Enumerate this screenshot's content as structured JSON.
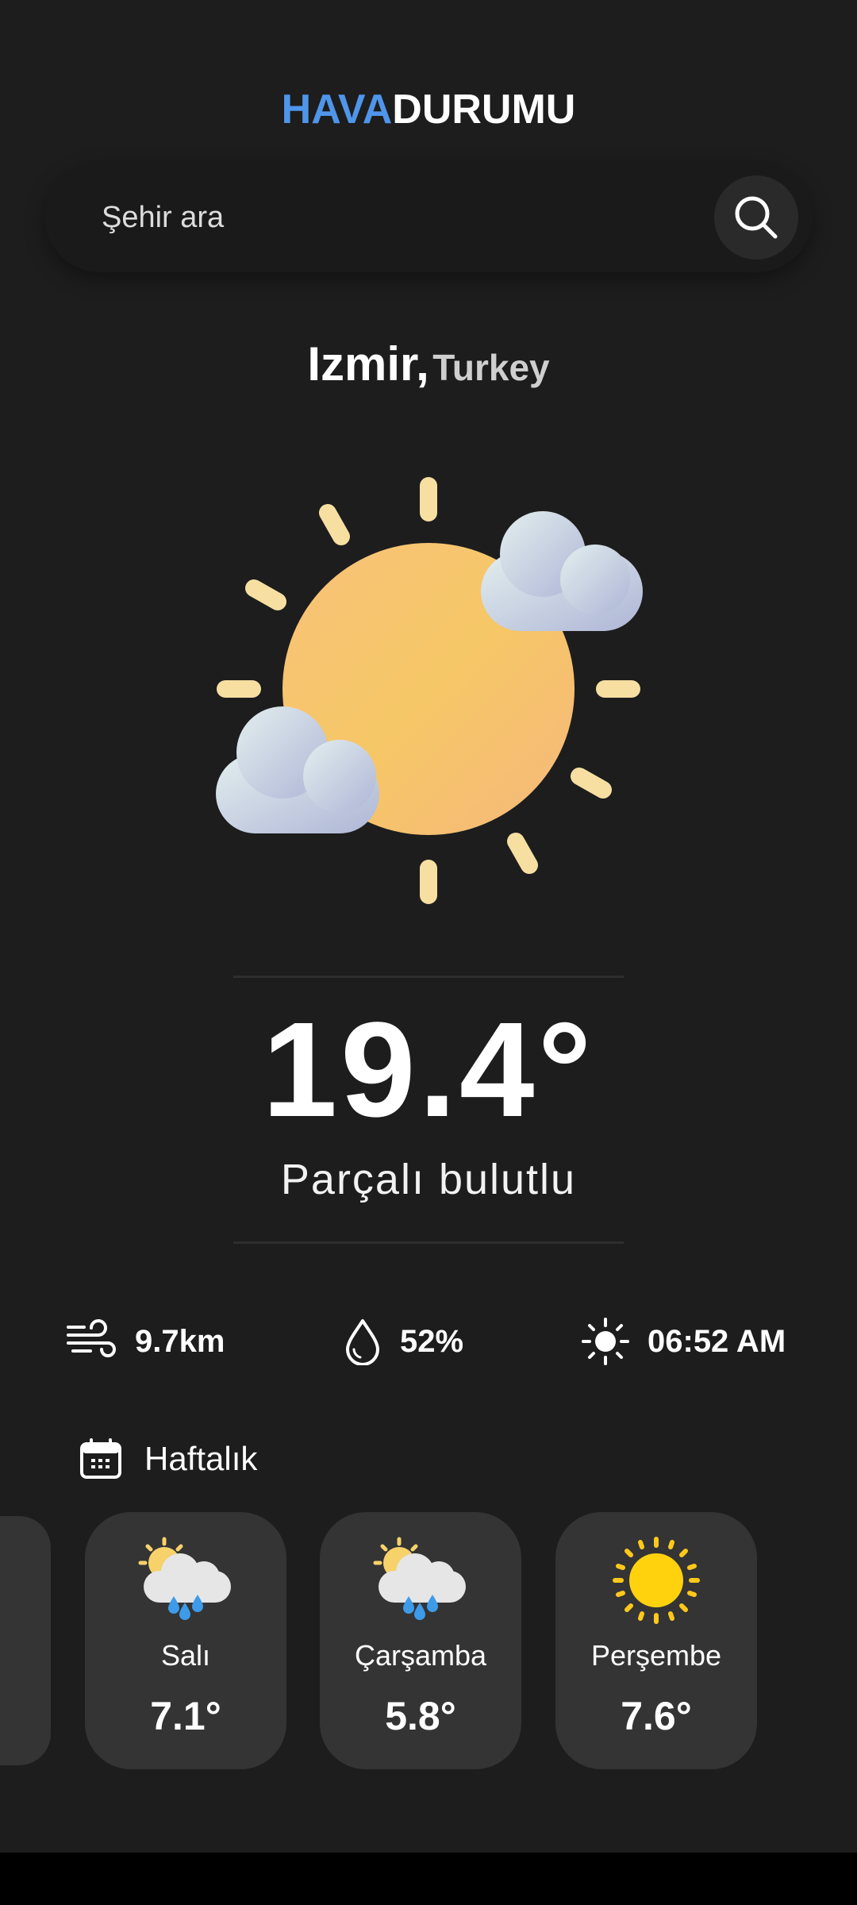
{
  "app_title": {
    "part1": "HAVA",
    "part2": "DURUMU"
  },
  "search": {
    "placeholder": "Şehir ara"
  },
  "location": {
    "city": "Izmir,",
    "country": "Turkey"
  },
  "current": {
    "temperature": "19.4°",
    "condition": "Parçalı bulutlu",
    "icon": "sun-behind-clouds-icon"
  },
  "stats": {
    "wind": "9.7km",
    "humidity": "52%",
    "sunrise": "06:52 AM"
  },
  "weekly": {
    "label": "Haftalık",
    "days": [
      {
        "day": "Salı",
        "temp": "7.1°",
        "icon": "sun-cloud-rain-icon"
      },
      {
        "day": "Çarşamba",
        "temp": "5.8°",
        "icon": "sun-cloud-rain-icon"
      },
      {
        "day": "Perşembe",
        "temp": "7.6°",
        "icon": "sun-icon"
      }
    ]
  },
  "colors": {
    "accent": "#4f95ea",
    "background": "#1d1d1d",
    "card": "#343434"
  }
}
